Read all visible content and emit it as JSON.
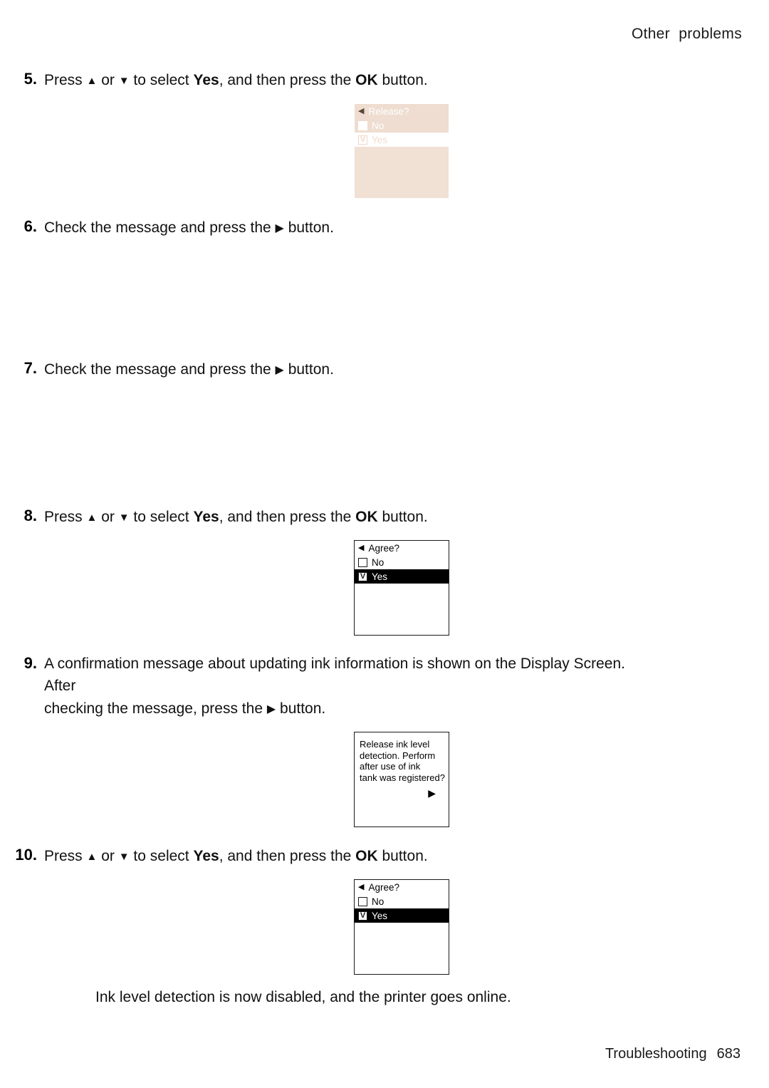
{
  "header": {
    "running_head": "Other  problems"
  },
  "footer": {
    "section": "Troubleshooting",
    "page_number": "683"
  },
  "glyphs": {
    "up": "▲",
    "down": "▼",
    "right": "▶",
    "left": "◀",
    "check": "V"
  },
  "steps": [
    {
      "number": "5.",
      "text_parts": {
        "a": "Press ",
        "b": " or ",
        "c": " to select ",
        "bold1": "Yes",
        "d": ", and then press the ",
        "bold2": "OK",
        "e": " button."
      }
    },
    {
      "number": "6.",
      "text": "Check the message and press the",
      "text_tail": "button."
    },
    {
      "number": "7.",
      "text": "Check the message and press the",
      "text_tail": "button."
    },
    {
      "number": "8.",
      "text_parts": {
        "a": "Press ",
        "b": " or ",
        "c": " to select ",
        "bold1": "Yes",
        "d": ", and then press the ",
        "bold2": "OK",
        "e": " button."
      }
    },
    {
      "number": "9.",
      "line1": "A confirmation message about updating ink information is shown on the Display Screen.  After",
      "line2_a": "checking the message, press the",
      "line2_b": "button."
    },
    {
      "number": "10.",
      "text_parts": {
        "a": "Press ",
        "b": " or ",
        "c": " to select ",
        "bold1": "Yes",
        "d": ", and then press the ",
        "bold2": "OK",
        "e": " button."
      }
    }
  ],
  "lcd_release": {
    "title": "Release?",
    "option_no": "No",
    "option_yes": "Yes",
    "selected": "Yes",
    "style": "faded",
    "bg_color": "#eeddd0",
    "fill_color": "#f1e0d4"
  },
  "lcd_agree_1": {
    "title": "Agree?",
    "option_no": "No",
    "option_yes": "Yes",
    "selected": "Yes"
  },
  "lcd_message": {
    "line1": "Release ink level",
    "line2": "detection. Perform",
    "line3": "after use of ink",
    "line4": "tank was registered?"
  },
  "lcd_agree_2": {
    "title": "Agree?",
    "option_no": "No",
    "option_yes": "Yes",
    "selected": "Yes"
  },
  "closing": {
    "text": "Ink level detection is now disabled, and the printer goes online."
  }
}
